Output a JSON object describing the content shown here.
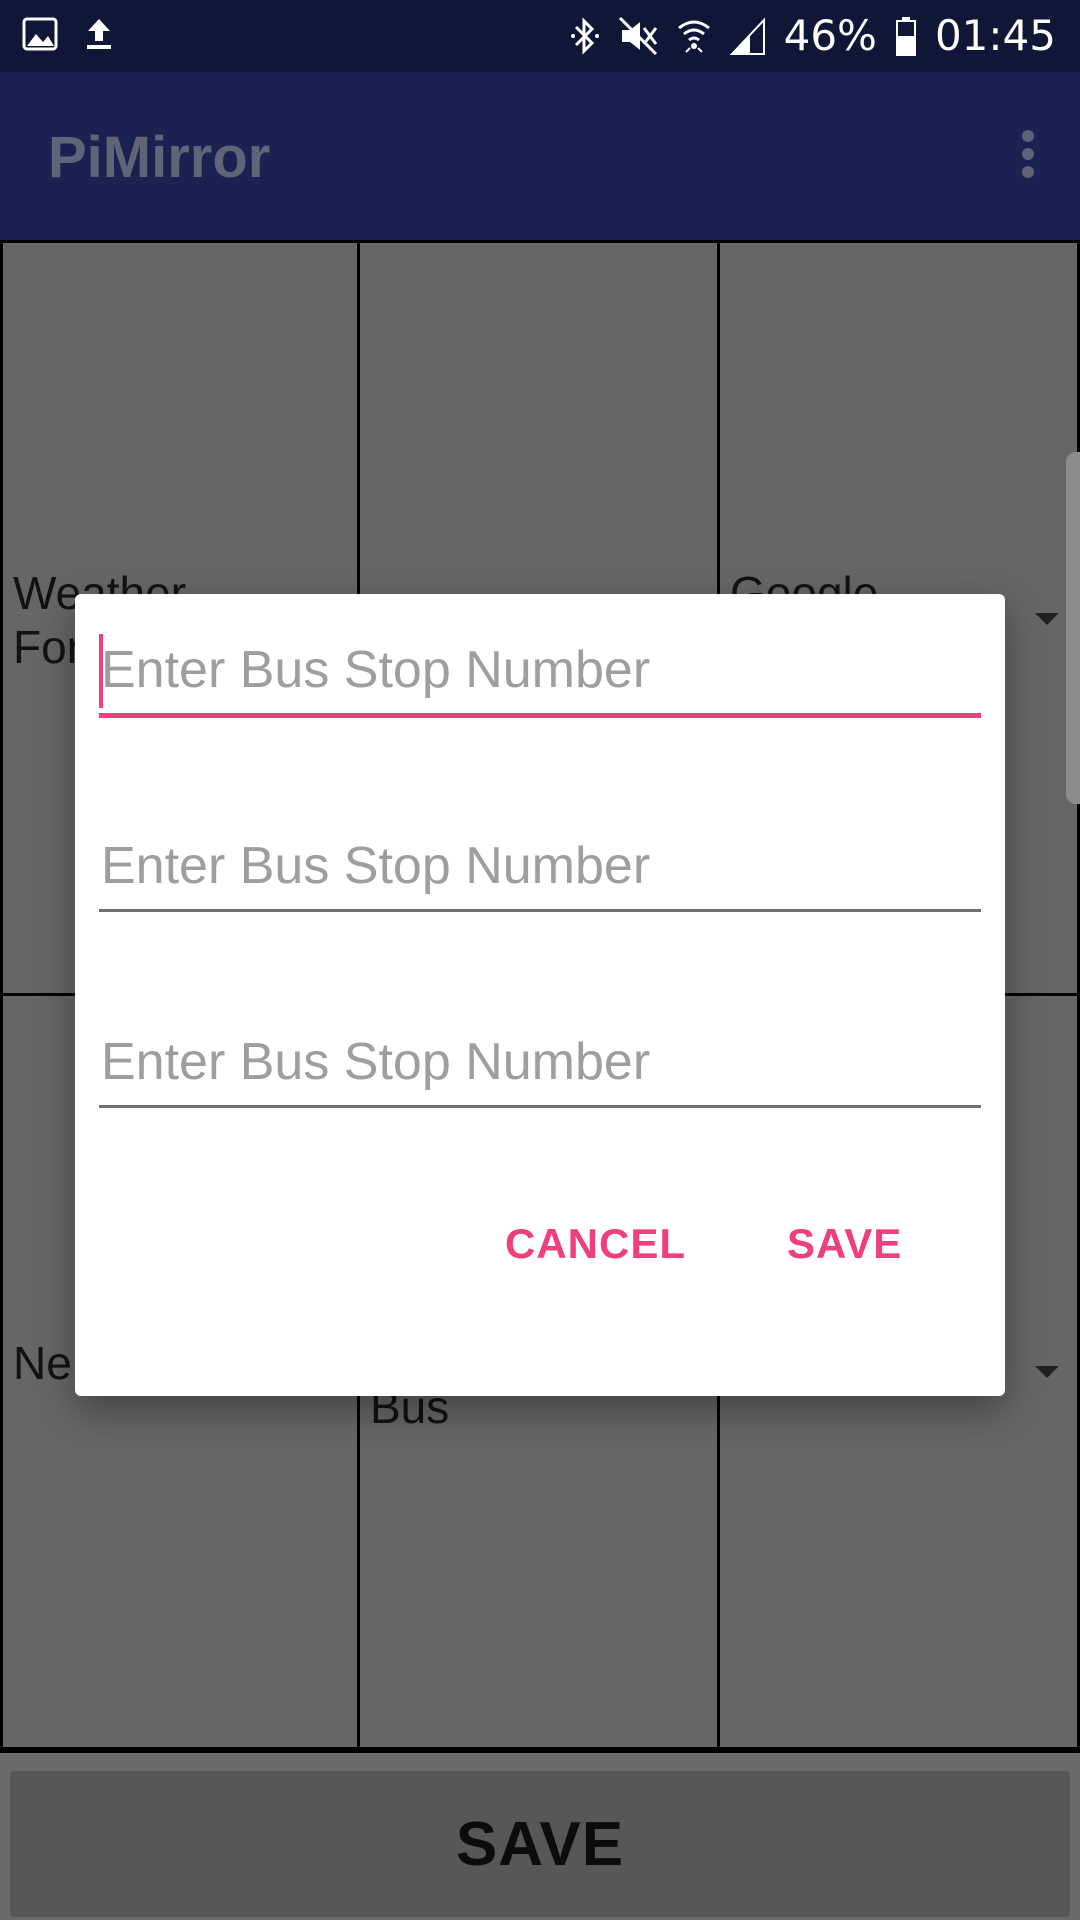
{
  "status_bar": {
    "icons_left": [
      "image-icon",
      "upload-icon"
    ],
    "icons_right": [
      "bluetooth-icon",
      "mute-icon",
      "wifi-icon",
      "signal-icon",
      "battery-icon"
    ],
    "battery": "46%",
    "time": "01:45"
  },
  "app_bar": {
    "title": "PiMirror",
    "menu_icon": "overflow-menu-icon"
  },
  "grid": {
    "cells": [
      {
        "label": "Weather-\nFor"
      },
      {
        "label": ""
      },
      {
        "label": "Google-"
      },
      {
        "label": "Ne"
      },
      {
        "label": "Bus"
      },
      {
        "label": ""
      }
    ]
  },
  "bottom_button": {
    "label": "SAVE"
  },
  "dialog": {
    "fields": [
      {
        "placeholder": "Enter Bus Stop Number",
        "value": ""
      },
      {
        "placeholder": "Enter Bus Stop Number",
        "value": ""
      },
      {
        "placeholder": "Enter Bus Stop Number",
        "value": ""
      }
    ],
    "cancel_label": "CANCEL",
    "save_label": "SAVE"
  },
  "colors": {
    "accent": "#ef3f7e",
    "status_bar": "#0f1636",
    "app_bar": "#1b2150"
  }
}
